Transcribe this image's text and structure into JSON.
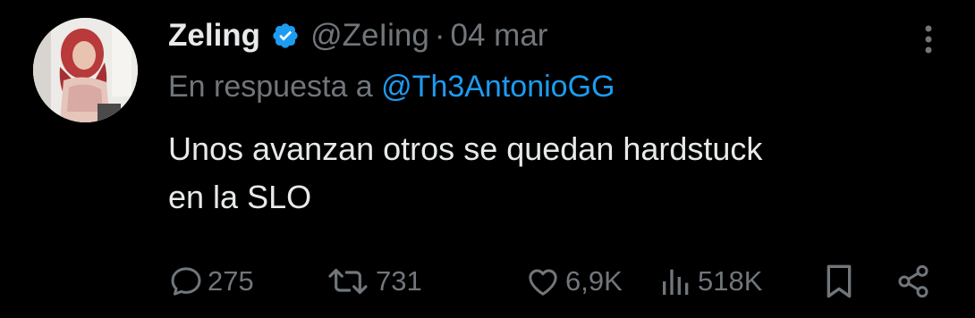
{
  "tweet": {
    "display_name": "Zeling",
    "handle": "@ZeIing",
    "separator": "·",
    "date": "04 mar",
    "reply_prefix": "En respuesta a ",
    "reply_mention": "@Th3AntonioGG",
    "text_line1": "Unos avanzan otros se quedan hardstuck",
    "text_line2": "en la SLO"
  },
  "actions": {
    "replies": "275",
    "retweets": "731",
    "likes": "6,9K",
    "views": "518K"
  },
  "colors": {
    "background": "#000000",
    "primary_text": "#e7e9ea",
    "secondary_text": "#71767b",
    "accent": "#1d9bf0"
  },
  "icons": [
    "verified-badge-icon",
    "more-options-icon",
    "reply-icon",
    "retweet-icon",
    "like-icon",
    "views-icon",
    "bookmark-icon",
    "share-icon"
  ]
}
